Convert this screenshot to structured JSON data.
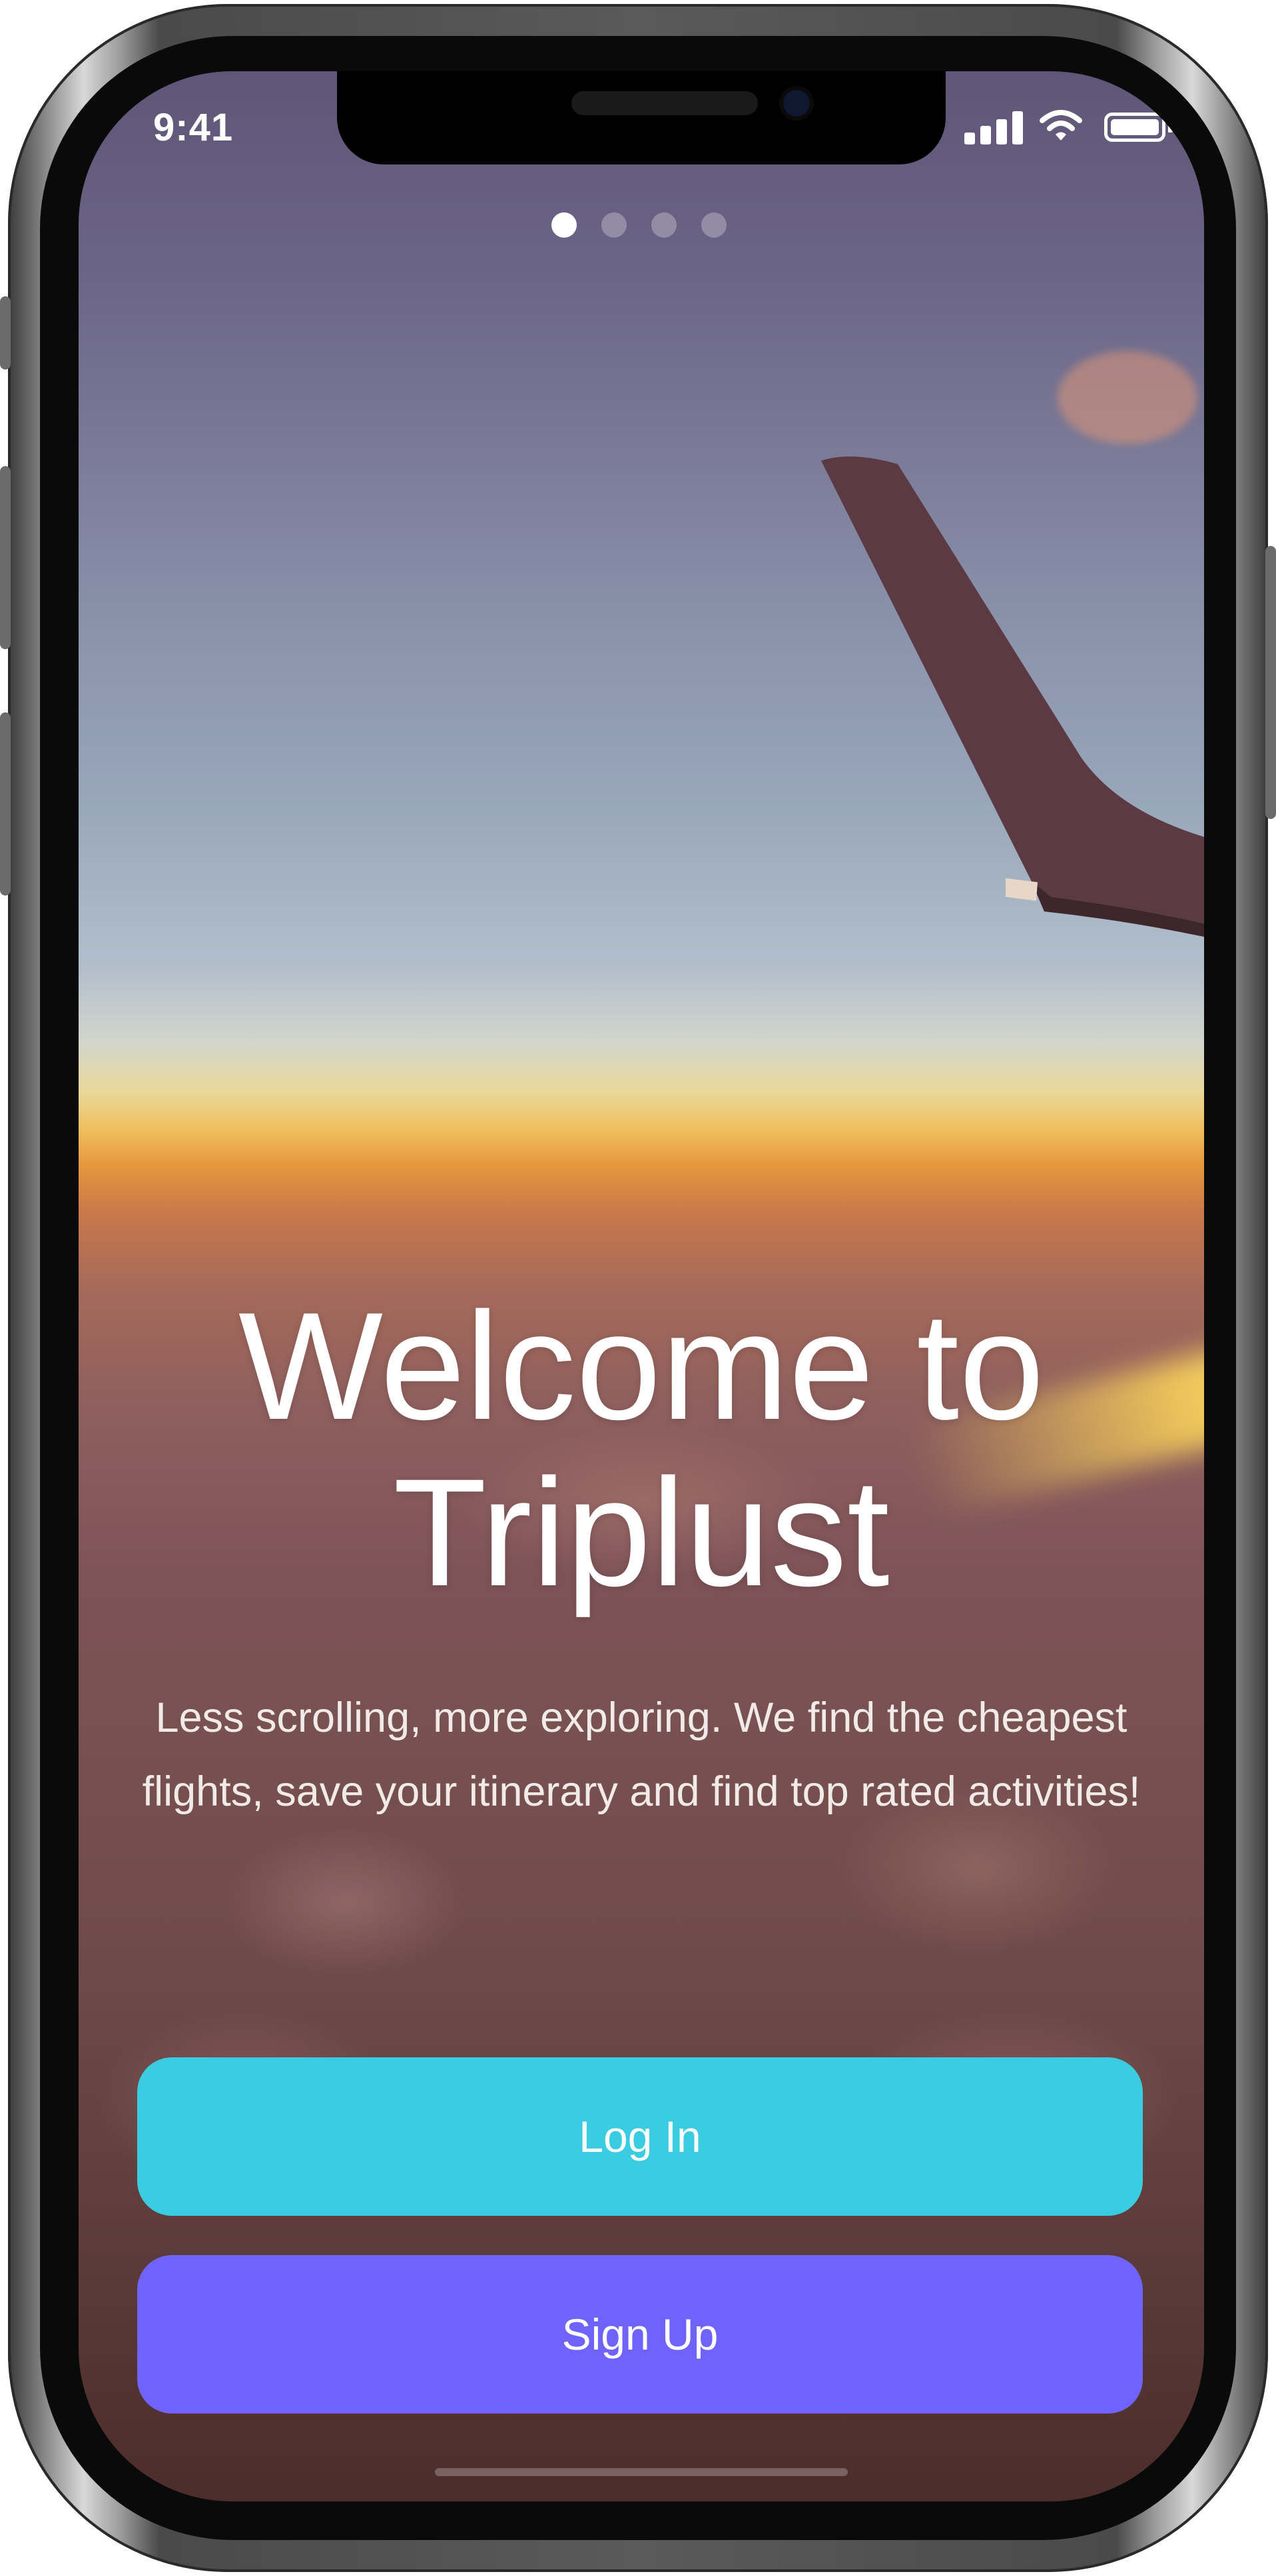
{
  "status_bar": {
    "time": "9:41"
  },
  "pager": {
    "count": 4,
    "active_index": 0
  },
  "welcome": {
    "title_line1": "Welcome to",
    "title_line2": "Triplust",
    "subtitle": "Less scrolling, more exploring. We find the cheapest flights, save your itinerary and find top rated activities!"
  },
  "buttons": {
    "login_label": "Log In",
    "signup_label": "Sign Up"
  },
  "colors": {
    "login_button": "#3ACCE1",
    "signup_button": "#6E63FA",
    "text": "#FFFFFF"
  },
  "icons": [
    "signal-icon",
    "wifi-icon",
    "battery-icon"
  ]
}
